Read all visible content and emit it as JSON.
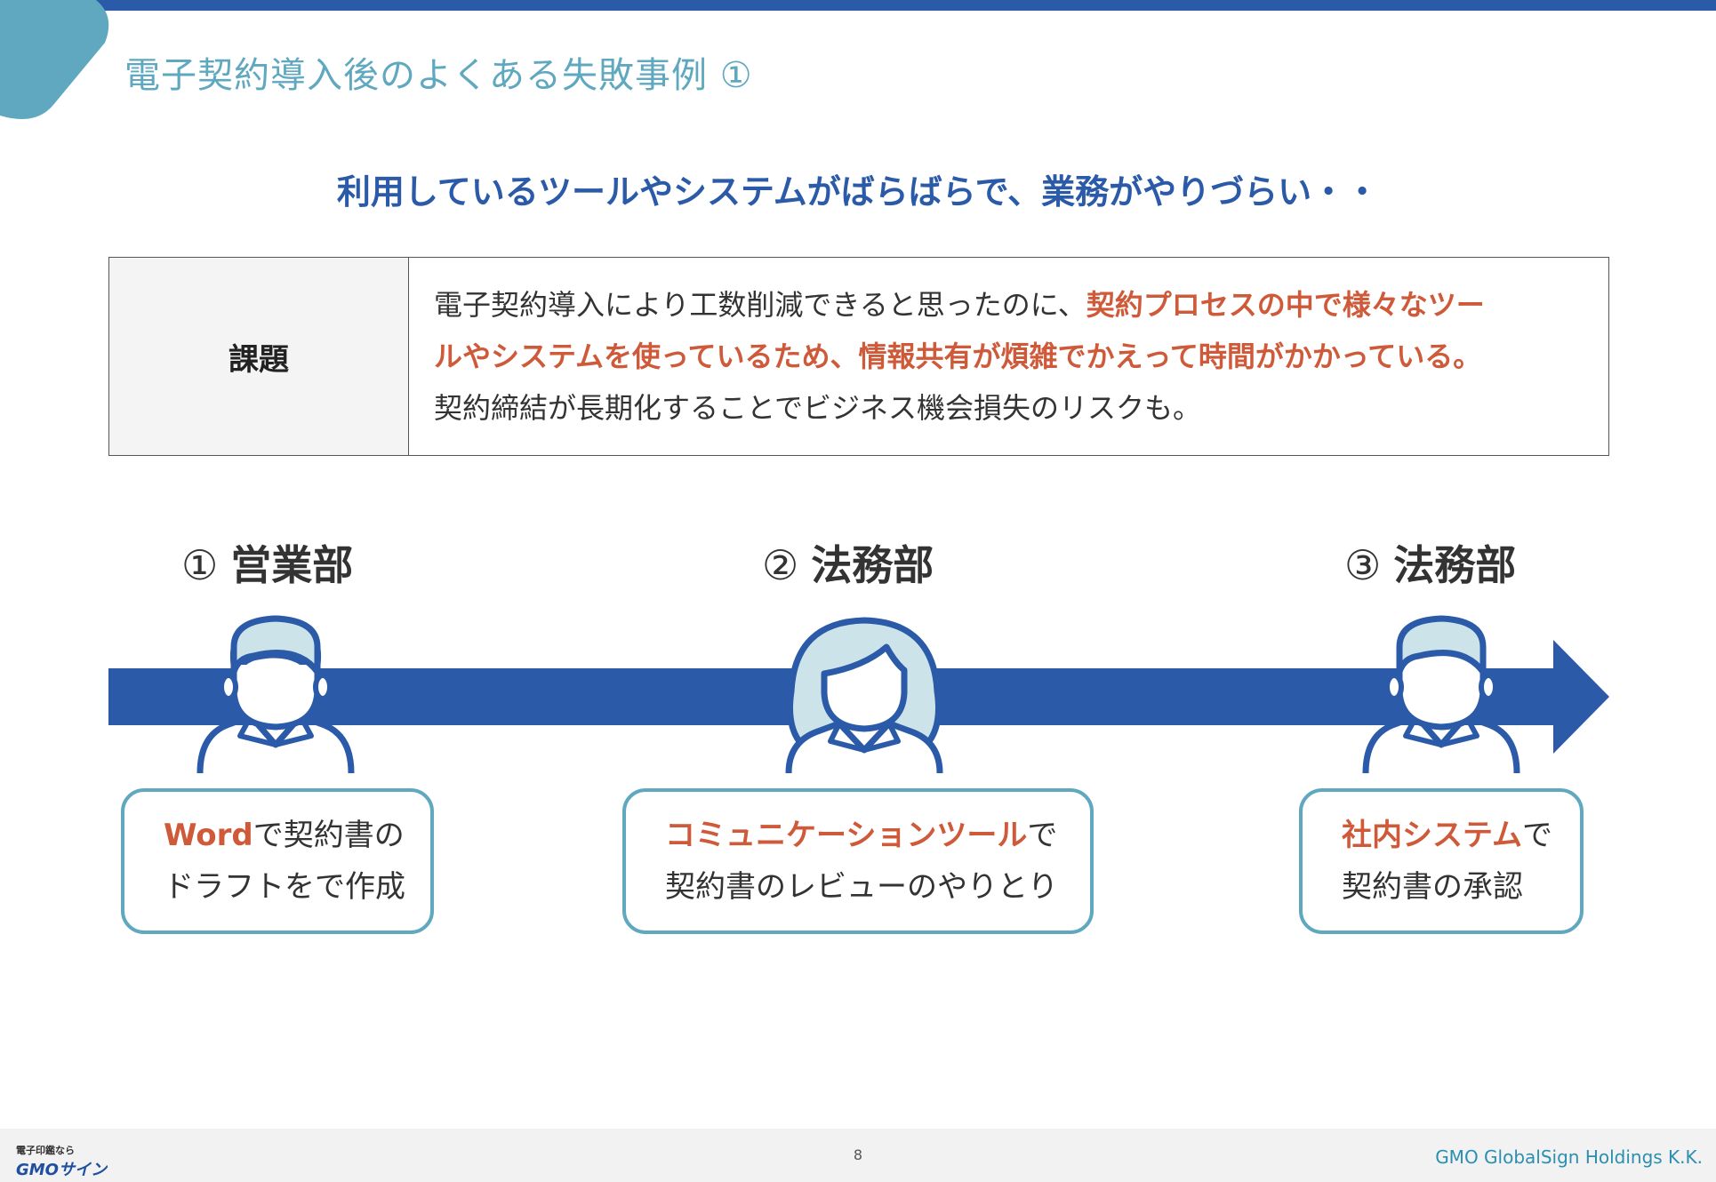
{
  "slide": {
    "title": "電子契約導入後のよくある失敗事例 ①",
    "headline": "利用しているツールやシステムがばらばらで、業務がやりづらい・・"
  },
  "issue": {
    "label": "課題",
    "line1_normal": "電子契約導入により工数削減できると思ったのに、",
    "line1_emphasis": "契約プロセスの中で様々なツー",
    "line2_emphasis": "ルやシステムを使っているため、情報共有が煩雑でかえって時間がかかっている。",
    "line3_normal": "契約締結が長期化することでビジネス機会損失のリスクも。"
  },
  "steps": [
    {
      "number": "①",
      "department": "営業部",
      "emphasis": "Word",
      "text1": "で契約書の",
      "text2": "ドラフトをで作成"
    },
    {
      "number": "②",
      "department": "法務部",
      "emphasis": "コミュニケーションツール",
      "text1": "で",
      "text2": "契約書のレビューのやりとり"
    },
    {
      "number": "③",
      "department": "法務部",
      "emphasis": "社内システム",
      "text1": "で",
      "text2": "契約書の承認"
    }
  ],
  "footer": {
    "logo_tagline": "電子印鑑なら",
    "logo_name": "GMOサイン",
    "page_number": "8",
    "company": "GMO GlobalSign Holdings K.K."
  },
  "colors": {
    "primary": "#2a5aa8",
    "accent": "#5fa8bf",
    "emphasis": "#cf5a3a"
  },
  "icons": [
    "user-male-icon",
    "user-female-icon",
    "arrow-right-icon"
  ]
}
